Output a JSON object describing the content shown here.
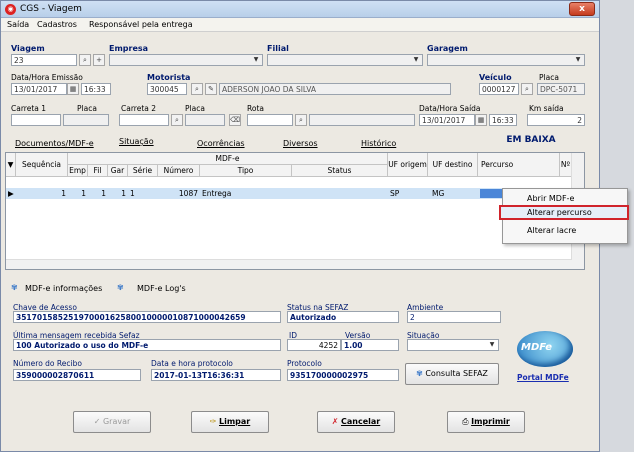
{
  "window": {
    "title": "CGS - Viagem",
    "close_glyph": "x",
    "app_icon": "red-circle-icon"
  },
  "menu": [
    "Saída",
    "Cadastros",
    "Responsável pela entrega"
  ],
  "form": {
    "viagem_label": "Viagem",
    "viagem_value": "23",
    "empresa_label": "Empresa",
    "filial_label": "Filial",
    "garagem_label": "Garagem",
    "emissao_label": "Data/Hora Emissão",
    "emissao_date": "13/01/2017",
    "emissao_time": "16:33",
    "motorista_label": "Motorista",
    "motorista_code": "300045",
    "motorista_name": "ADERSON JOAO DA SILVA",
    "veiculo_label": "Veículo",
    "veiculo_code": "0000127",
    "placa_label": "Placa",
    "placa_value": "DPC-5071",
    "carreta1_label": "Carreta 1",
    "placa1_label": "Placa",
    "carreta2_label": "Carreta 2",
    "placa2_label": "Placa",
    "rota_label": "Rota",
    "saida_label": "Data/Hora Saída",
    "saida_date": "13/01/2017",
    "saida_time": "16:33",
    "km_label": "Km saída",
    "km_value": "2"
  },
  "tabs": [
    "Documentos/MDF-e",
    "Situação",
    "Ocorrências",
    "Diversos",
    "Histórico"
  ],
  "status_text": "EM BAIXA",
  "grid": {
    "group_header": "MDF-e",
    "columns": [
      "Sequência",
      "Emp",
      "Fil",
      "Gar",
      "Série",
      "Número",
      "Tipo",
      "Status",
      "UF origem",
      "UF destino",
      "Percurso",
      "Nº"
    ],
    "row": {
      "seq": "1",
      "emp": "1",
      "fil": "1",
      "gar": "1",
      "serie": "1",
      "numero": "1087",
      "tipo": "Entrega",
      "uf_origem": "SP",
      "uf_destino": "MG"
    }
  },
  "context_menu": [
    "Abrir MDF-e",
    "Alterar percurso",
    "Alterar lacre"
  ],
  "subtabs": [
    "MDF-e informações",
    "MDF-e Log's"
  ],
  "info": {
    "chave_label": "Chave de Acesso",
    "chave_value": "35170158525197000162580010000010871000042659",
    "status_sefaz_label": "Status na SEFAZ",
    "status_sefaz_value": "Autorizado",
    "ambiente_label": "Ambiente",
    "ambiente_value": "2",
    "ultima_msg_label": "Última mensagem recebida Sefaz",
    "ultima_msg_value": "100 Autorizado o uso do MDF-e",
    "id_label": "ID",
    "id_value": "4252",
    "versao_label": "Versão",
    "versao_value": "1.00",
    "situacao_label": "Situação",
    "recibo_label": "Número do Recibo",
    "recibo_value": "359000002870611",
    "protocolo_dt_label": "Data e hora protocolo",
    "protocolo_dt_value": "2017-01-13T16:36:31",
    "protocolo_label": "Protocolo",
    "protocolo_value": "935170000002975",
    "consulta_btn": "Consulta SEFAZ",
    "portal_logo": "MDFe",
    "portal_link": "Portal MDFe"
  },
  "buttons": {
    "gravar": "Gravar",
    "limpar": "Limpar",
    "cancelar": "Cancelar",
    "imprimir": "Imprimir"
  }
}
